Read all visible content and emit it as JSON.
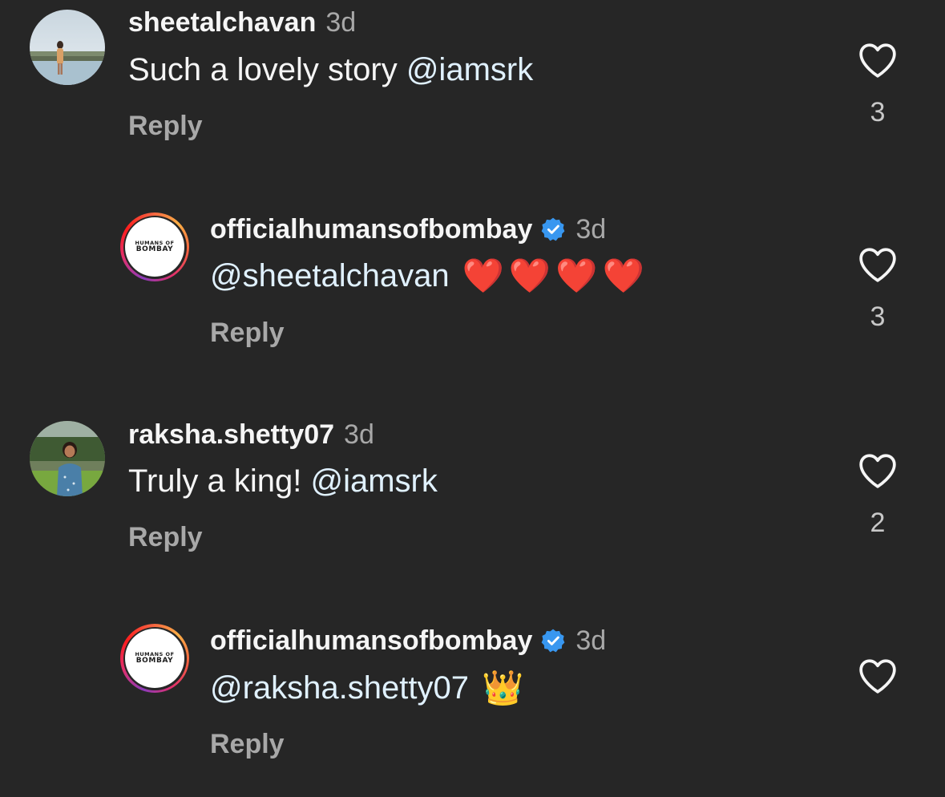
{
  "comments": [
    {
      "username": "sheetalchavan",
      "time": "3d",
      "text": "Such a lovely story",
      "mention": "@iamsrk",
      "reply_label": "Reply",
      "likes": "3"
    },
    {
      "username": "officialhumansofbombay",
      "verified": true,
      "time": "3d",
      "mention": "@sheetalchavan",
      "emoji": "❤️❤️❤️❤️",
      "reply_label": "Reply",
      "likes": "3",
      "avatar_text_top": "HUMANS OF",
      "avatar_text_bottom": "BOMBAY"
    },
    {
      "username": "raksha.shetty07",
      "time": "3d",
      "text": "Truly a king!",
      "mention": "@iamsrk",
      "reply_label": "Reply",
      "likes": "2"
    },
    {
      "username": "officialhumansofbombay",
      "verified": true,
      "time": "3d",
      "mention": "@raksha.shetty07",
      "emoji": "👑",
      "reply_label": "Reply",
      "likes": "",
      "avatar_text_top": "HUMANS OF",
      "avatar_text_bottom": "BOMBAY"
    }
  ],
  "colors": {
    "background": "#262626",
    "primary_text": "#f5f5f5",
    "secondary_text": "#a8a8a8",
    "mention": "#e0f1ff",
    "verified_badge": "#3897f0"
  },
  "icons": {
    "like": "heart-outline-icon",
    "verified": "verified-badge-icon"
  }
}
